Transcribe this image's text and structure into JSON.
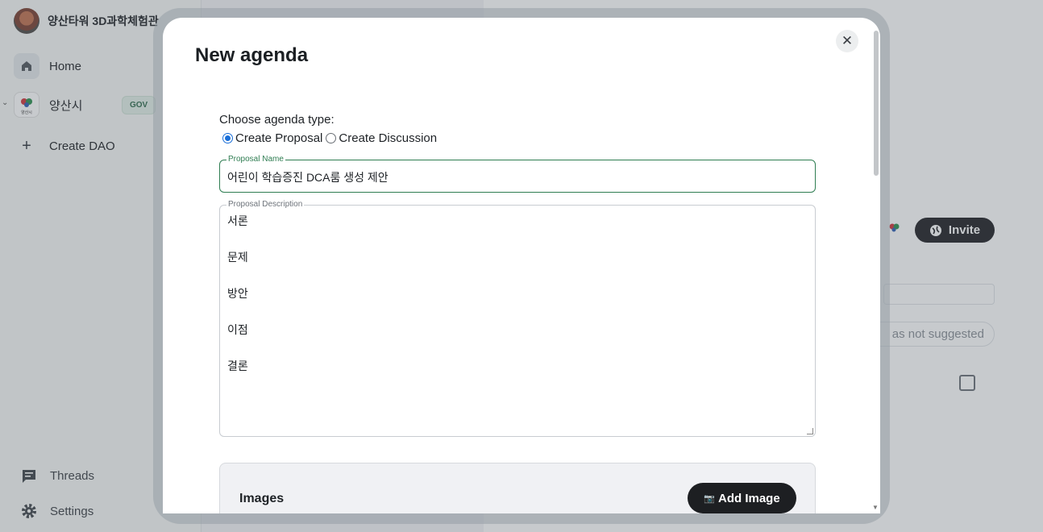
{
  "sidebar": {
    "org_title": "양산타워 3D과학체험관",
    "home_label": "Home",
    "dao_name": "양산시",
    "dao_badge": "GOV",
    "dao_logo_text": "양산시",
    "create_dao_label": "Create DAO",
    "threads_label": "Threads",
    "settings_label": "Settings"
  },
  "background": {
    "invite_label": "Invite",
    "not_suggested_text": "as not suggested"
  },
  "modal": {
    "title": "New agenda",
    "agenda_type_label": "Choose agenda type:",
    "options": [
      {
        "label": "Create Proposal",
        "checked": true
      },
      {
        "label": "Create Discussion",
        "checked": false
      }
    ],
    "proposal_name_label": "Proposal Name",
    "proposal_name_value": "어린이 학습증진 DCA룸 생성 제안",
    "proposal_description_label": "Proposal Description",
    "description_lines": [
      "서론",
      "문제",
      "방안",
      "이점",
      "결론"
    ],
    "images_label": "Images",
    "add_image_label": "Add Image",
    "add_image_emoji": "📷"
  },
  "colors": {
    "accent_green": "#2f7d52",
    "radio_blue": "#1a6fd8",
    "dark_button": "#1d1f22"
  }
}
